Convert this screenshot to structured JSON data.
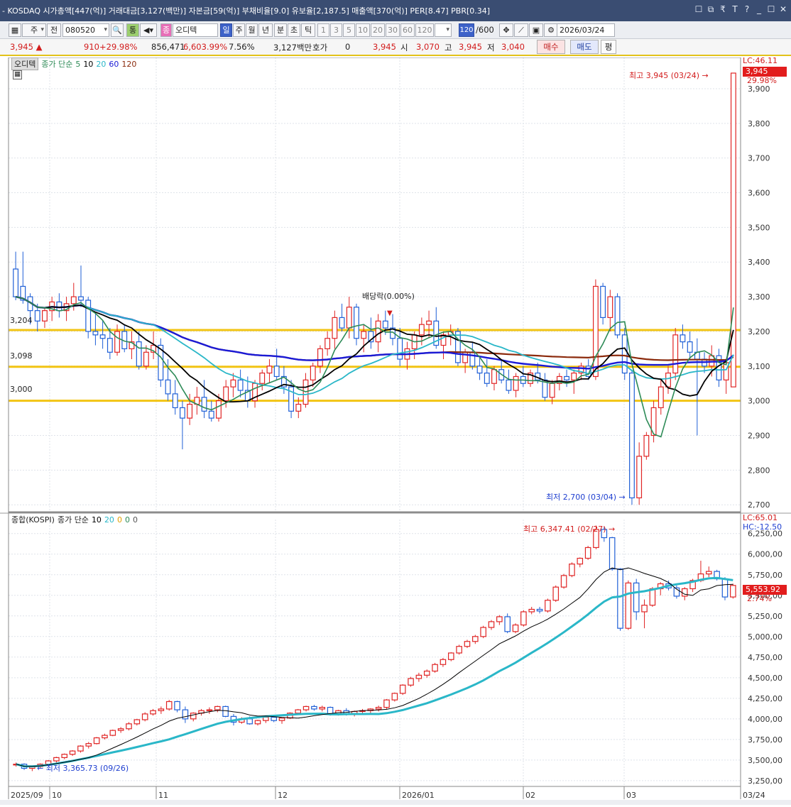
{
  "titlebar": {
    "text": "- KOSDAQ 시가총액[447(억)] 거래대금[3,127(백만)] 자본금[59(억)] 부채비율[9.0] 유보율[2,187.5] 매출액[370(억)] PER[8.47] PBR[0.34]",
    "controls": [
      "☐",
      "⧉",
      "₹",
      "T",
      "?",
      "_",
      "☐",
      "✕"
    ]
  },
  "toolbar": {
    "period_label": "주",
    "prev_label": "전",
    "code": "080520",
    "tong_label": "통",
    "name_badge": "종",
    "stock_name": "오디텍",
    "periods": [
      "일",
      "주",
      "월",
      "년",
      "분",
      "초",
      "틱"
    ],
    "intervals": [
      "1",
      "3",
      "5",
      "10",
      "20",
      "30",
      "60",
      "120"
    ],
    "count": "120",
    "count_total": "/600",
    "date": "2026/03/24"
  },
  "quote": {
    "price": "3,945",
    "change": "910",
    "change_pct": "+29.98%",
    "volume": "856,471",
    "volume_pct": "6,603.99%",
    "turnover": "7.56%",
    "amount": "3,127백만",
    "hoga_label": "호가",
    "hoga": "0",
    "price2": "3,945",
    "open_label": "시",
    "open": "3,070",
    "high_label": "고",
    "high": "3,945",
    "low_label": "저",
    "low": "3,040",
    "buy_label": "매수",
    "sell_label": "매도",
    "eval_label": "평"
  },
  "upper_legend": {
    "name": "오디텍",
    "ma_label": "종가 단순",
    "ma": [
      {
        "label": "5",
        "color": "#2e8b57"
      },
      {
        "label": "10",
        "color": "#000000"
      },
      {
        "label": "20",
        "color": "#2ab7c8"
      },
      {
        "label": "60",
        "color": "#1a1ad6"
      },
      {
        "label": "120",
        "color": "#8b2a0c"
      }
    ]
  },
  "upper_annotations": {
    "high_note": "최고 3,945 (03/24)",
    "low_note": "최저 2,700 (03/04)",
    "dividend_note": "배당락(0.00%)",
    "lc_label": "LC:46.11",
    "price_tag": "3,945",
    "pct_tag": "29.98%",
    "hline_labels": [
      "3,204",
      "3,098",
      "3,000"
    ]
  },
  "lower_legend": {
    "name": "종합(KOSPI)",
    "ma_label": "종가 단순",
    "ma": [
      {
        "label": "10",
        "color": "#000000"
      },
      {
        "label": "20",
        "color": "#2ab7c8"
      },
      {
        "label": "0",
        "color": "#e0a000"
      },
      {
        "label": "0",
        "color": "#2e8b57"
      },
      {
        "label": "0",
        "color": "#555555"
      }
    ]
  },
  "lower_annotations": {
    "high_note": "최고 6,347.41 (02/27)",
    "low_note": "최저 3,365.73 (09/26)",
    "lc_label": "LC:65.01",
    "hc_label": "HC:-12.50",
    "price_tag": "5,553.92",
    "pct_tag": "2.74%"
  },
  "x_axis_labels": [
    "2025/09",
    "10",
    "11",
    "12",
    "2026/01",
    "02",
    "03",
    "03/24"
  ],
  "chart_data": [
    {
      "type": "candlestick",
      "series_name": "오디텍",
      "y_axis_ticks": [
        2700,
        2800,
        2900,
        3000,
        3100,
        3200,
        3300,
        3400,
        3500,
        3600,
        3700,
        3800,
        3900
      ],
      "ylim": [
        2680,
        3990
      ],
      "horizontal_lines": [
        3204,
        3098,
        3000
      ],
      "ohlc": [
        [
          3380,
          3430,
          3290,
          3300
        ],
        [
          3330,
          3430,
          3280,
          3290
        ],
        [
          3300,
          3310,
          3220,
          3260
        ],
        [
          3260,
          3280,
          3200,
          3230
        ],
        [
          3230,
          3270,
          3210,
          3260
        ],
        [
          3260,
          3300,
          3230,
          3285
        ],
        [
          3285,
          3310,
          3240,
          3260
        ],
        [
          3260,
          3300,
          3230,
          3280
        ],
        [
          3280,
          3340,
          3260,
          3300
        ],
        [
          3300,
          3390,
          3270,
          3290
        ],
        [
          3290,
          3300,
          3180,
          3200
        ],
        [
          3200,
          3250,
          3160,
          3190
        ],
        [
          3190,
          3230,
          3150,
          3180
        ],
        [
          3180,
          3210,
          3120,
          3140
        ],
        [
          3140,
          3220,
          3130,
          3200
        ],
        [
          3200,
          3220,
          3140,
          3150
        ],
        [
          3150,
          3200,
          3120,
          3170
        ],
        [
          3170,
          3200,
          3090,
          3100
        ],
        [
          3100,
          3160,
          3090,
          3140
        ],
        [
          3140,
          3200,
          3120,
          3160
        ],
        [
          3160,
          3180,
          3040,
          3060
        ],
        [
          3060,
          3120,
          3000,
          3020
        ],
        [
          3020,
          3060,
          2960,
          2980
        ],
        [
          2980,
          3000,
          2860,
          2950
        ],
        [
          2950,
          3020,
          2930,
          2990
        ],
        [
          2990,
          3040,
          2960,
          3010
        ],
        [
          3010,
          3060,
          2950,
          2970
        ],
        [
          2970,
          3000,
          2940,
          2950
        ],
        [
          2950,
          3020,
          2940,
          3000
        ],
        [
          3000,
          3060,
          2980,
          3040
        ],
        [
          3040,
          3080,
          3010,
          3060
        ],
        [
          3060,
          3090,
          3010,
          3030
        ],
        [
          3030,
          3070,
          2980,
          3000
        ],
        [
          3000,
          3060,
          2980,
          3050
        ],
        [
          3050,
          3090,
          3030,
          3080
        ],
        [
          3080,
          3120,
          3050,
          3100
        ],
        [
          3100,
          3150,
          3060,
          3070
        ],
        [
          3070,
          3100,
          3020,
          3040
        ],
        [
          3040,
          3060,
          2950,
          2970
        ],
        [
          2970,
          3010,
          2950,
          2990
        ],
        [
          2990,
          3080,
          2980,
          3060
        ],
        [
          3060,
          3110,
          3040,
          3100
        ],
        [
          3100,
          3160,
          3080,
          3150
        ],
        [
          3150,
          3200,
          3130,
          3180
        ],
        [
          3180,
          3260,
          3150,
          3240
        ],
        [
          3240,
          3280,
          3200,
          3210
        ],
        [
          3210,
          3300,
          3180,
          3270
        ],
        [
          3270,
          3280,
          3160,
          3180
        ],
        [
          3180,
          3220,
          3140,
          3200
        ],
        [
          3200,
          3240,
          3150,
          3170
        ],
        [
          3170,
          3250,
          3140,
          3230
        ],
        [
          3230,
          3260,
          3190,
          3210
        ],
        [
          3210,
          3250,
          3160,
          3180
        ],
        [
          3180,
          3210,
          3100,
          3120
        ],
        [
          3120,
          3170,
          3090,
          3150
        ],
        [
          3150,
          3200,
          3120,
          3190
        ],
        [
          3190,
          3240,
          3160,
          3220
        ],
        [
          3220,
          3260,
          3180,
          3230
        ],
        [
          3230,
          3270,
          3150,
          3160
        ],
        [
          3160,
          3200,
          3120,
          3190
        ],
        [
          3190,
          3220,
          3160,
          3200
        ],
        [
          3200,
          3210,
          3100,
          3110
        ],
        [
          3110,
          3150,
          3080,
          3140
        ],
        [
          3140,
          3170,
          3090,
          3100
        ],
        [
          3100,
          3130,
          3060,
          3080
        ],
        [
          3080,
          3120,
          3040,
          3050
        ],
        [
          3050,
          3100,
          3030,
          3090
        ],
        [
          3090,
          3120,
          3050,
          3060
        ],
        [
          3060,
          3090,
          3020,
          3030
        ],
        [
          3030,
          3080,
          3010,
          3070
        ],
        [
          3070,
          3100,
          3040,
          3050
        ],
        [
          3050,
          3090,
          3040,
          3080
        ],
        [
          3080,
          3110,
          3050,
          3060
        ],
        [
          3060,
          3080,
          3000,
          3010
        ],
        [
          3010,
          3060,
          2990,
          3050
        ],
        [
          3050,
          3080,
          3030,
          3070
        ],
        [
          3070,
          3090,
          3040,
          3060
        ],
        [
          3060,
          3090,
          3020,
          3080
        ],
        [
          3080,
          3110,
          3060,
          3100
        ],
        [
          3100,
          3120,
          3060,
          3070
        ],
        [
          3070,
          3350,
          3060,
          3330
        ],
        [
          3330,
          3340,
          3220,
          3240
        ],
        [
          3240,
          3320,
          3200,
          3300
        ],
        [
          3300,
          3310,
          3180,
          3190
        ],
        [
          3190,
          3210,
          3060,
          3080
        ],
        [
          3080,
          3090,
          2700,
          2720
        ],
        [
          2720,
          2880,
          2700,
          2840
        ],
        [
          2840,
          2910,
          2830,
          2900
        ],
        [
          2900,
          3000,
          2880,
          2980
        ],
        [
          2980,
          3060,
          2960,
          3040
        ],
        [
          3040,
          3100,
          3020,
          3080
        ],
        [
          3080,
          3210,
          3060,
          3190
        ],
        [
          3190,
          3220,
          3150,
          3170
        ],
        [
          3170,
          3200,
          3120,
          3140
        ],
        [
          3140,
          3180,
          2900,
          3120
        ],
        [
          3120,
          3140,
          3080,
          3100
        ],
        [
          3100,
          3160,
          3070,
          3130
        ],
        [
          3130,
          3150,
          3040,
          3060
        ],
        [
          3060,
          3120,
          3020,
          3110
        ],
        [
          3040,
          3945,
          3040,
          3945
        ]
      ]
    },
    {
      "type": "candlestick",
      "series_name": "종합(KOSPI)",
      "y_axis_ticks": [
        3250,
        3500,
        3750,
        4000,
        4250,
        4500,
        4750,
        5000,
        5250,
        5500,
        5750,
        6000,
        6250
      ],
      "ylim": [
        3180,
        6420
      ],
      "ohlc": [
        [
          3440,
          3470,
          3420,
          3450
        ],
        [
          3450,
          3460,
          3380,
          3400
        ],
        [
          3400,
          3430,
          3366,
          3420
        ],
        [
          3420,
          3460,
          3400,
          3450
        ],
        [
          3450,
          3500,
          3430,
          3490
        ],
        [
          3490,
          3540,
          3470,
          3530
        ],
        [
          3530,
          3580,
          3510,
          3570
        ],
        [
          3570,
          3620,
          3550,
          3610
        ],
        [
          3610,
          3680,
          3590,
          3670
        ],
        [
          3670,
          3720,
          3640,
          3700
        ],
        [
          3700,
          3780,
          3690,
          3770
        ],
        [
          3770,
          3820,
          3750,
          3800
        ],
        [
          3800,
          3870,
          3790,
          3860
        ],
        [
          3860,
          3900,
          3830,
          3880
        ],
        [
          3880,
          3960,
          3860,
          3940
        ],
        [
          3940,
          4000,
          3920,
          3990
        ],
        [
          3990,
          4080,
          3970,
          4060
        ],
        [
          4060,
          4120,
          4040,
          4100
        ],
        [
          4100,
          4150,
          4060,
          4120
        ],
        [
          4120,
          4230,
          4100,
          4210
        ],
        [
          4210,
          4220,
          4080,
          4110
        ],
        [
          4110,
          4150,
          3950,
          4000
        ],
        [
          4000,
          4080,
          3970,
          4070
        ],
        [
          4070,
          4120,
          4040,
          4100
        ],
        [
          4100,
          4140,
          4060,
          4110
        ],
        [
          4110,
          4160,
          4080,
          4150
        ],
        [
          4150,
          4160,
          4020,
          4030
        ],
        [
          4030,
          4060,
          3920,
          3960
        ],
        [
          3960,
          4020,
          3940,
          4000
        ],
        [
          4000,
          4030,
          3930,
          3940
        ],
        [
          3940,
          3990,
          3920,
          3980
        ],
        [
          3980,
          4040,
          3950,
          4020
        ],
        [
          4020,
          4050,
          3960,
          3980
        ],
        [
          3980,
          4020,
          3940,
          4010
        ],
        [
          4010,
          4080,
          4000,
          4070
        ],
        [
          4070,
          4120,
          4050,
          4110
        ],
        [
          4110,
          4160,
          4090,
          4150
        ],
        [
          4150,
          4170,
          4100,
          4120
        ],
        [
          4120,
          4160,
          4090,
          4140
        ],
        [
          4140,
          4150,
          4040,
          4060
        ],
        [
          4060,
          4110,
          4040,
          4100
        ],
        [
          4100,
          4130,
          4040,
          4060
        ],
        [
          4060,
          4100,
          4030,
          4090
        ],
        [
          4090,
          4120,
          4060,
          4100
        ],
        [
          4100,
          4130,
          4070,
          4120
        ],
        [
          4120,
          4160,
          4090,
          4140
        ],
        [
          4140,
          4240,
          4120,
          4230
        ],
        [
          4230,
          4320,
          4210,
          4310
        ],
        [
          4310,
          4420,
          4290,
          4410
        ],
        [
          4410,
          4510,
          4390,
          4490
        ],
        [
          4490,
          4560,
          4450,
          4530
        ],
        [
          4530,
          4600,
          4500,
          4580
        ],
        [
          4580,
          4680,
          4560,
          4660
        ],
        [
          4660,
          4740,
          4630,
          4720
        ],
        [
          4720,
          4810,
          4700,
          4800
        ],
        [
          4800,
          4900,
          4780,
          4880
        ],
        [
          4880,
          4960,
          4860,
          4940
        ],
        [
          4940,
          5020,
          4910,
          5000
        ],
        [
          5000,
          5130,
          4980,
          5110
        ],
        [
          5110,
          5200,
          5080,
          5180
        ],
        [
          5180,
          5260,
          5140,
          5240
        ],
        [
          5240,
          5280,
          5040,
          5060
        ],
        [
          5060,
          5160,
          5040,
          5140
        ],
        [
          5140,
          5320,
          5120,
          5300
        ],
        [
          5300,
          5360,
          5270,
          5330
        ],
        [
          5330,
          5360,
          5280,
          5310
        ],
        [
          5310,
          5460,
          5290,
          5440
        ],
        [
          5440,
          5620,
          5420,
          5600
        ],
        [
          5600,
          5760,
          5580,
          5740
        ],
        [
          5740,
          5900,
          5720,
          5880
        ],
        [
          5880,
          5960,
          5840,
          5950
        ],
        [
          5950,
          6100,
          5930,
          6080
        ],
        [
          6080,
          6347,
          6060,
          6300
        ],
        [
          6300,
          6330,
          6150,
          6200
        ],
        [
          6200,
          6210,
          5800,
          5820
        ],
        [
          5820,
          5830,
          5070,
          5100
        ],
        [
          5100,
          5680,
          5080,
          5650
        ],
        [
          5650,
          5700,
          5200,
          5300
        ],
        [
          5300,
          5450,
          5100,
          5380
        ],
        [
          5380,
          5600,
          5360,
          5580
        ],
        [
          5580,
          5660,
          5500,
          5640
        ],
        [
          5640,
          5680,
          5560,
          5590
        ],
        [
          5590,
          5620,
          5460,
          5490
        ],
        [
          5490,
          5600,
          5440,
          5580
        ],
        [
          5580,
          5700,
          5540,
          5680
        ],
        [
          5680,
          5920,
          5660,
          5760
        ],
        [
          5760,
          5850,
          5720,
          5790
        ],
        [
          5790,
          5810,
          5680,
          5700
        ],
        [
          5700,
          5720,
          5440,
          5480
        ],
        [
          5480,
          5640,
          5460,
          5620
        ]
      ]
    }
  ]
}
